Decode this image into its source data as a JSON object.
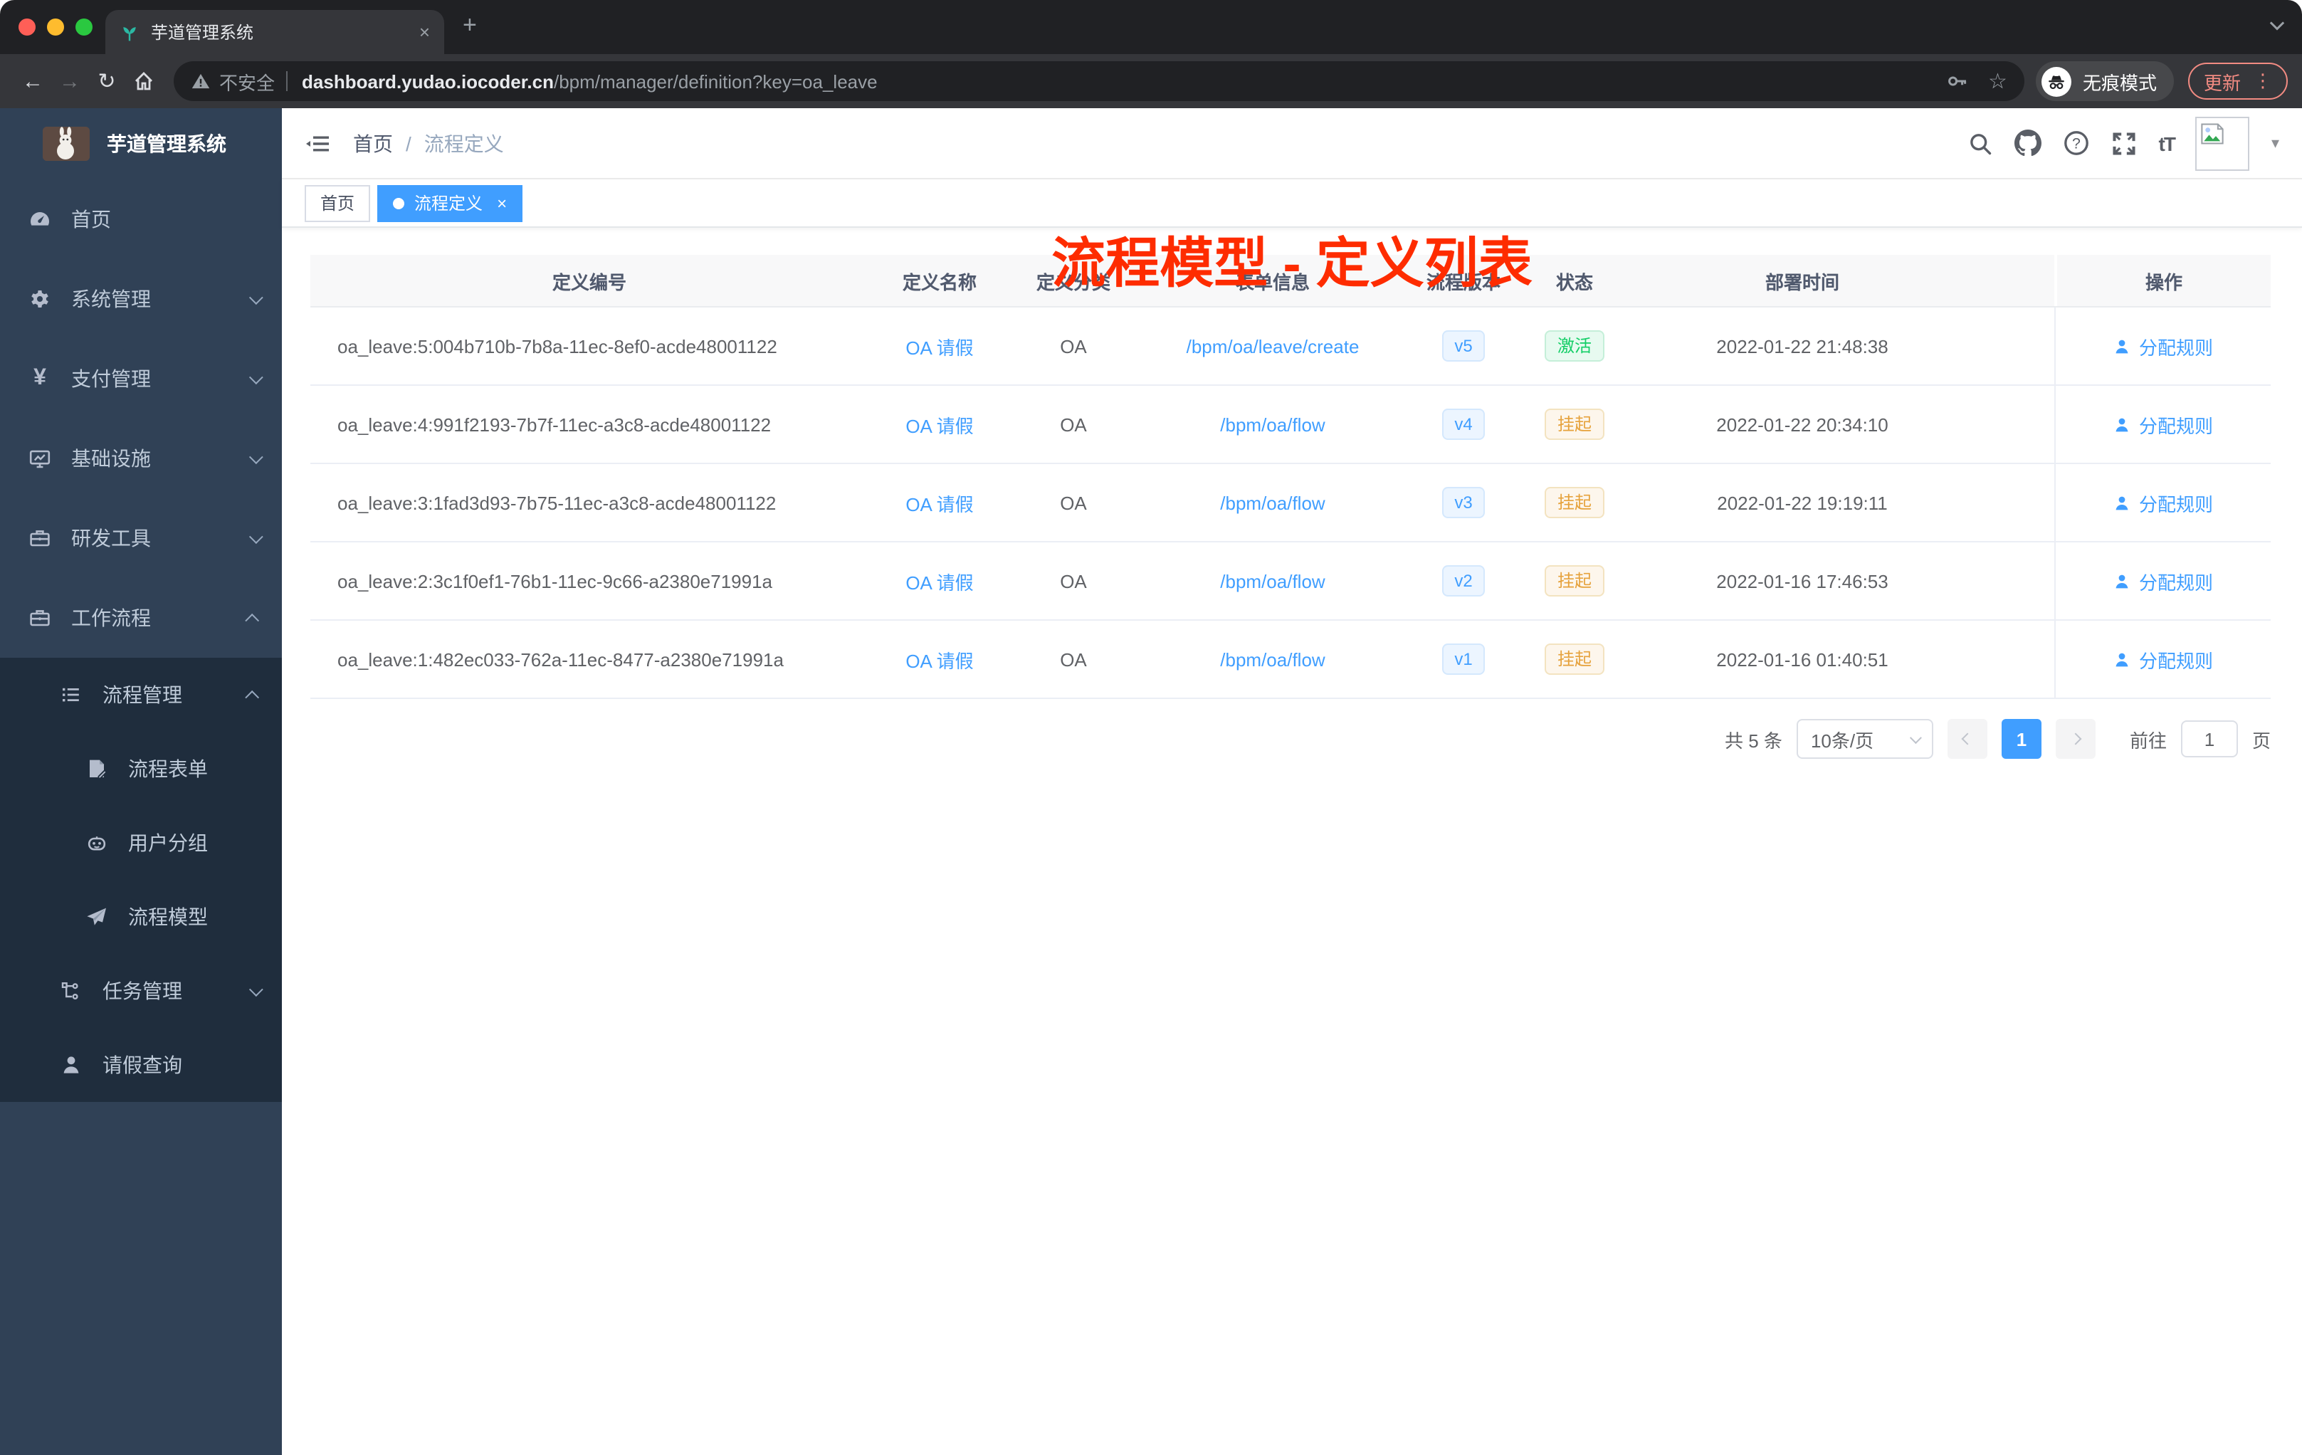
{
  "browser": {
    "tab_title": "芋道管理系统",
    "security_label": "不安全",
    "url_host": "dashboard.yudao.iocoder.cn",
    "url_path": "/bpm/manager/definition?key=oa_leave",
    "incognito_label": "无痕模式",
    "update_label": "更新"
  },
  "icons": {
    "close": "×",
    "new_tab": "+",
    "back": "←",
    "forward": "→",
    "reload": "↻",
    "star": "☆",
    "menu_dots": "⋮",
    "caret_down": "▾",
    "text_size": "tT",
    "yen": "¥"
  },
  "sidebar": {
    "app_title": "芋道管理系统",
    "menu": [
      {
        "label": "首页"
      },
      {
        "label": "系统管理"
      },
      {
        "label": "支付管理"
      },
      {
        "label": "基础设施"
      },
      {
        "label": "研发工具"
      },
      {
        "label": "工作流程"
      }
    ],
    "submenu": [
      {
        "label": "流程管理"
      },
      {
        "label": "流程表单"
      },
      {
        "label": "用户分组"
      },
      {
        "label": "流程模型"
      },
      {
        "label": "任务管理"
      },
      {
        "label": "请假查询"
      }
    ]
  },
  "navbar": {
    "breadcrumb_home": "首页",
    "breadcrumb_sep": "/",
    "breadcrumb_current": "流程定义"
  },
  "annotation": {
    "text": "流程模型 - 定义列表",
    "color": "#fe2c00"
  },
  "tags": {
    "home": "首页",
    "active": "流程定义"
  },
  "table": {
    "headers": [
      "定义编号",
      "定义名称",
      "定义分类",
      "表单信息",
      "流程版本",
      "状态",
      "部署时间",
      "操作"
    ],
    "action_label": "分配规则",
    "rows": [
      {
        "id": "oa_leave:5:004b710b-7b8a-11ec-8ef0-acde48001122",
        "name": "OA 请假",
        "category": "OA",
        "form": "/bpm/oa/leave/create",
        "version": "v5",
        "status": "激活",
        "time": "2022-01-22 21:48:38"
      },
      {
        "id": "oa_leave:4:991f2193-7b7f-11ec-a3c8-acde48001122",
        "name": "OA 请假",
        "category": "OA",
        "form": "/bpm/oa/flow",
        "version": "v4",
        "status": "挂起",
        "time": "2022-01-22 20:34:10"
      },
      {
        "id": "oa_leave:3:1fad3d93-7b75-11ec-a3c8-acde48001122",
        "name": "OA 请假",
        "category": "OA",
        "form": "/bpm/oa/flow",
        "version": "v3",
        "status": "挂起",
        "time": "2022-01-22 19:19:11"
      },
      {
        "id": "oa_leave:2:3c1f0ef1-76b1-11ec-9c66-a2380e71991a",
        "name": "OA 请假",
        "category": "OA",
        "form": "/bpm/oa/flow",
        "version": "v2",
        "status": "挂起",
        "time": "2022-01-16 17:46:53"
      },
      {
        "id": "oa_leave:1:482ec033-762a-11ec-8477-a2380e71991a",
        "name": "OA 请假",
        "category": "OA",
        "form": "/bpm/oa/flow",
        "version": "v1",
        "status": "挂起",
        "time": "2022-01-16 01:40:51"
      }
    ]
  },
  "pagination": {
    "total": "共 5 条",
    "page_size": "10条/页",
    "page": "1",
    "goto_label": "前往",
    "goto_value": "1",
    "unit_label": "页"
  },
  "colors": {
    "primary": "#409eff",
    "success": "#13ce66",
    "warning": "#e6a23c",
    "annotation_red": "#fe2c00",
    "sidebar_bg": "#304156",
    "submenu_bg": "#1f2d3d"
  }
}
